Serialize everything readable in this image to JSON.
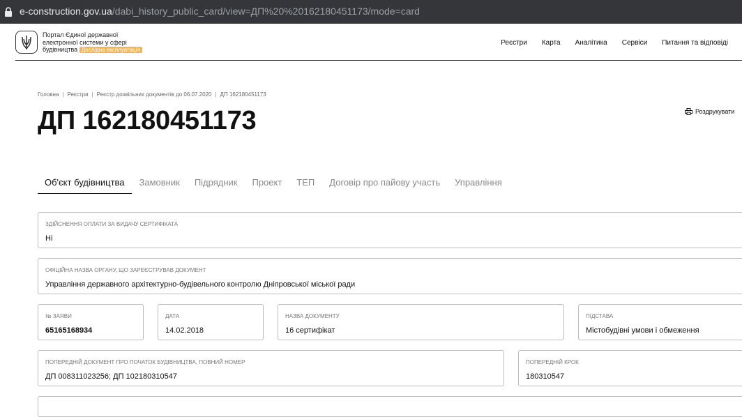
{
  "browser": {
    "url_host": "e-construction.gov.ua",
    "url_path": "/dabi_history_public_card/view=ДП%20%20162180451173/mode=card"
  },
  "header": {
    "portal_line1": "Портал Єдиної державної",
    "portal_line2": "електронної системи у сфері",
    "portal_line3": "будівництва",
    "badge": "Дослідна експлуатація",
    "nav": [
      "Реєстри",
      "Карта",
      "Аналітика",
      "Сервіси",
      "Питання та відповіді"
    ]
  },
  "breadcrumb": [
    "Головна",
    "Реєстри",
    "Реєстр дозвільних документів до 06.07.2020",
    "ДП 162180451173"
  ],
  "page": {
    "title": "ДП 162180451173",
    "print_label": "Роздрукувати"
  },
  "tabs": [
    "Об'єкт будівництва",
    "Замовник",
    "Підрядник",
    "Проект",
    "ТЕП",
    "Договір про пайову участь",
    "Управління"
  ],
  "fields": {
    "payment": {
      "label": "Здійснення оплати за видачу сертифіката",
      "value": "Ні"
    },
    "authority": {
      "label": "Офіційна назва органу, що зареєстрував документ",
      "value": "Управління державного архітектурно-будівельного контролю Дніпровської міської ради"
    },
    "app_no": {
      "label": "№ заяви",
      "value": "65165168934"
    },
    "date": {
      "label": "Дата",
      "value": "14.02.2018"
    },
    "doc_name": {
      "label": "Назва документу",
      "value": "16 сертифікат"
    },
    "basis": {
      "label": "Підстава",
      "value": "Містобудівні умови і обмеження"
    },
    "prev_doc": {
      "label": "Попередній документ про початок будівництва, повний номер",
      "value": "ДП 008311023256; ДП 102180310547"
    },
    "prev_step": {
      "label": "Попередній крок",
      "value": "180310547"
    }
  },
  "colors": {
    "badge": "#f0b45a",
    "urlbar": "#35363a"
  }
}
